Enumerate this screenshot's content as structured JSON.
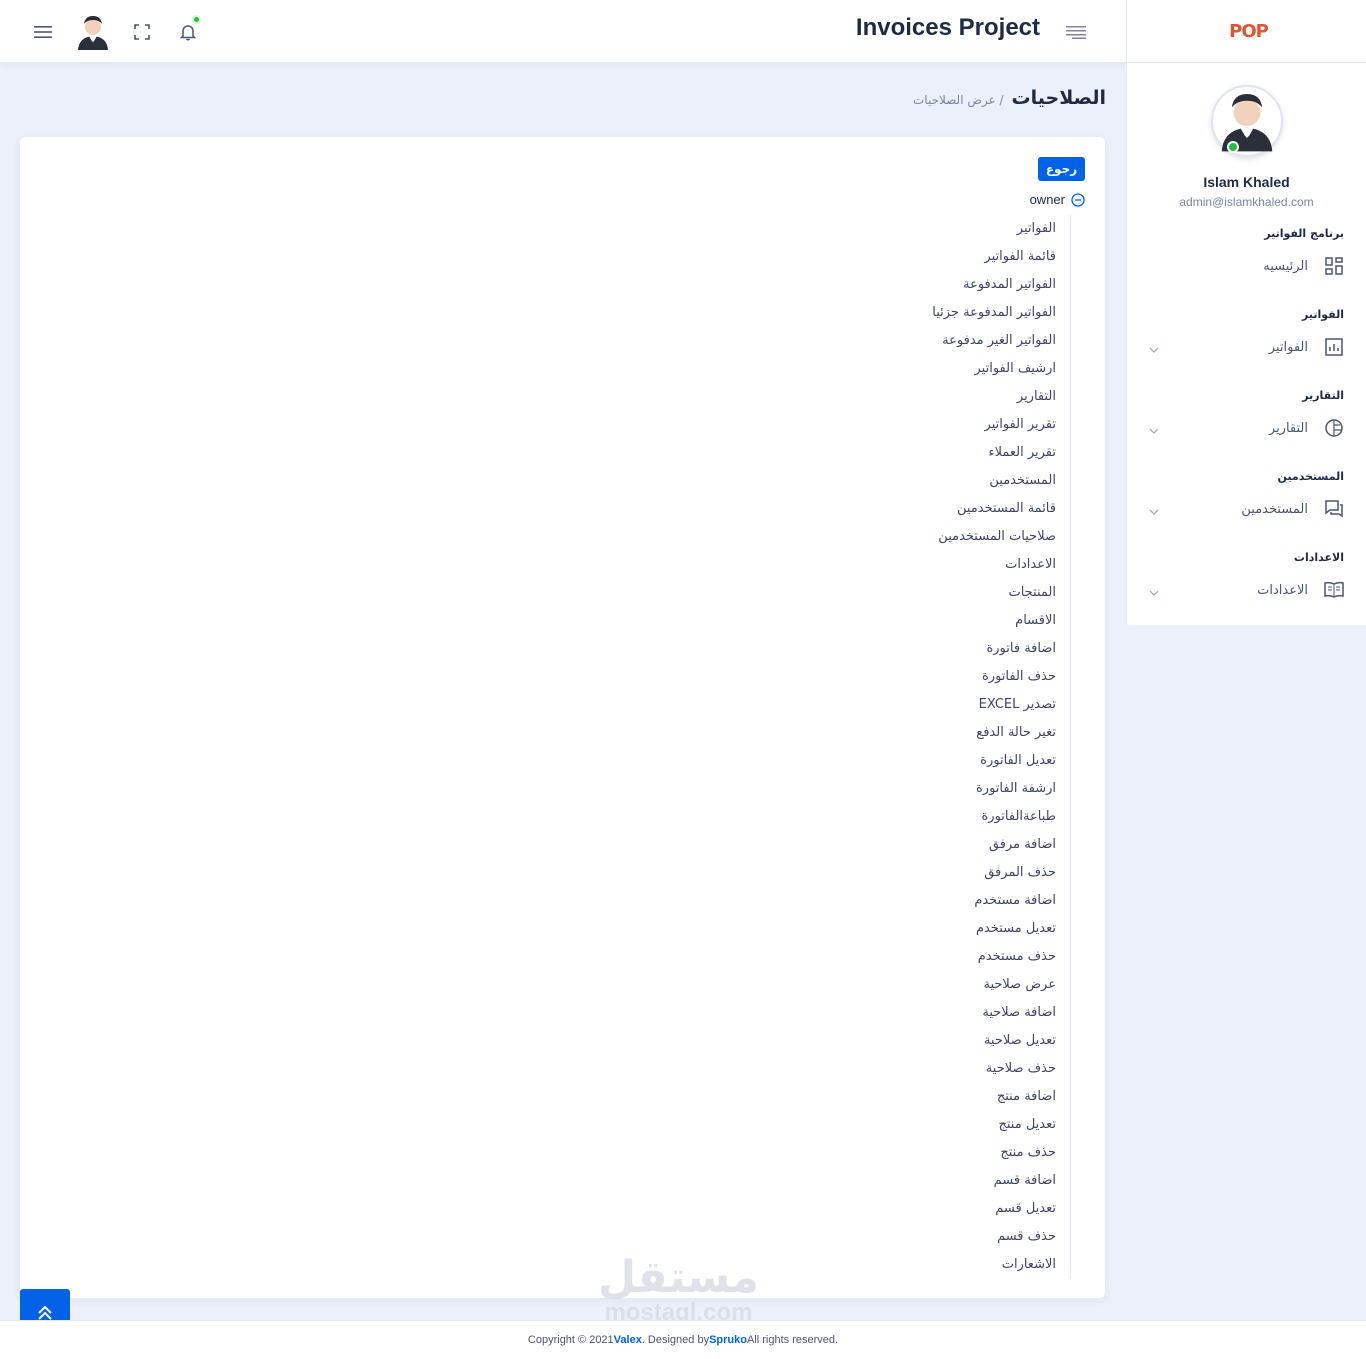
{
  "header": {
    "title": "Invoices Project",
    "icons": [
      "menu-icon",
      "avatar",
      "fullscreen-icon",
      "bell-icon",
      "sidebar-toggle-icon"
    ]
  },
  "sidebar": {
    "logo": "POP",
    "profile": {
      "name": "Islam Khaled",
      "email": "admin@islamkhaled.com"
    },
    "sections": [
      {
        "category": "برنامج الفواتير",
        "label": "الرئيسيه",
        "icon": "dashboard-icon",
        "has_chevron": false
      },
      {
        "category": "الفواتير",
        "label": "الفواتير",
        "icon": "bar-chart-icon",
        "has_chevron": true
      },
      {
        "category": "التقارير",
        "label": "التقارير",
        "icon": "pie-chart-icon",
        "has_chevron": true
      },
      {
        "category": "المستخدمين",
        "label": "المستخدمين",
        "icon": "chat-icon",
        "has_chevron": true
      },
      {
        "category": "الاعدادات",
        "label": "الاعدادات",
        "icon": "book-icon",
        "has_chevron": true
      }
    ]
  },
  "breadcrumb": {
    "title": "الصلاحيات",
    "current": "/ عرض الصلاحيات"
  },
  "card": {
    "back_label": "رجوع",
    "role": "owner",
    "permissions": [
      "الفواتير",
      "قائمة الفواتير",
      "الفواتير المدفوعة",
      "الفواتير المدفوعة جزئيا",
      "الفواتير الغير مدفوعة",
      "ارشيف الفواتير",
      "التقارير",
      "تقرير الفواتير",
      "تقرير العملاء",
      "المستخدمين",
      "قائمة المستخدمين",
      "صلاحيات المستخدمين",
      "الاعدادات",
      "المنتجات",
      "الاقسام",
      "اضافة فاتورة",
      "حذف الفاتورة",
      "تصدير EXCEL",
      "تغير حالة الدفع",
      "تعديل الفاتورة",
      "ارشفة الفاتورة",
      "طباعةالفاتورة",
      "اضافة مرفق",
      "حذف المرفق",
      "اضافة مستخدم",
      "تعديل مستخدم",
      "حذف مستخدم",
      "عرض صلاحية",
      "اضافة صلاحية",
      "تعديل صلاحية",
      "حذف صلاحية",
      "اضافة منتج",
      "تعديل منتج",
      "حذف منتج",
      "اضافة قسم",
      "تعديل قسم",
      "حذف قسم",
      "الاشعارات"
    ]
  },
  "watermark": {
    "ar": "مستقل",
    "en": "mostaql.com"
  },
  "footer": {
    "prefix": "Copyright © 2021 ",
    "brand": "Valex",
    "middle": ". Designed by ",
    "designer": "Spruko",
    "suffix": " All rights reserved."
  },
  "colors": {
    "primary": "#0162e8",
    "online": "#22c03c",
    "text": "#1f2a44",
    "bg": "#ecf0fa"
  }
}
